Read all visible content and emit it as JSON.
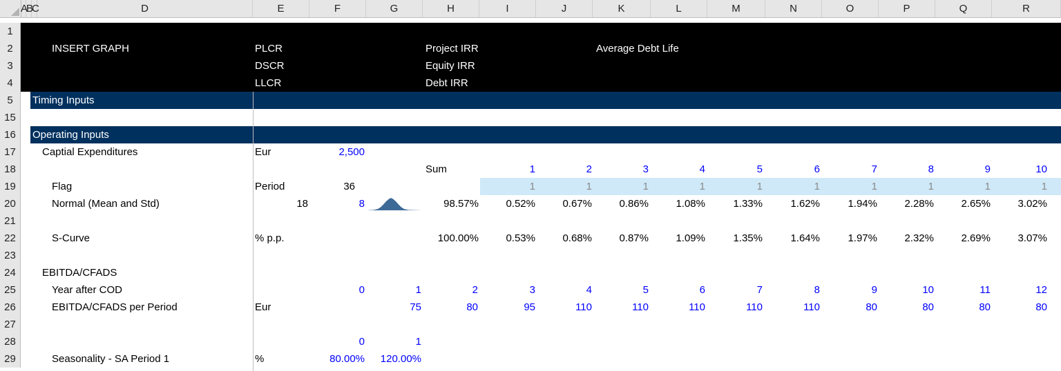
{
  "column_headers": [
    "A",
    "B",
    "C",
    "D",
    "E",
    "F",
    "G",
    "H",
    "I",
    "J",
    "K",
    "L",
    "M",
    "N",
    "O",
    "P",
    "Q",
    "R"
  ],
  "row_headers": [
    "1",
    "2",
    "3",
    "4",
    "5",
    "15",
    "16",
    "17",
    "18",
    "19",
    "20",
    "21",
    "22",
    "23",
    "24",
    "25",
    "26",
    "27",
    "28",
    "29"
  ],
  "header_block": {
    "insert_graph": "INSERT GRAPH",
    "plcr": "PLCR",
    "dscr": "DSCR",
    "llcr": "LLCR",
    "project_irr": "Project IRR",
    "equity_irr": "Equity IRR",
    "debt_irr": "Debt IRR",
    "average_debt_life": "Average Debt Life"
  },
  "sections": {
    "timing_inputs": "Timing Inputs",
    "operating_inputs": "Operating Inputs"
  },
  "capex": {
    "label": "Captial Expenditures",
    "unit": "Eur",
    "value": "2,500"
  },
  "period_row": {
    "sum_label": "Sum",
    "periods": [
      "1",
      "2",
      "3",
      "4",
      "5",
      "6",
      "7",
      "8",
      "9",
      "10"
    ]
  },
  "flag": {
    "label": "Flag",
    "unit": "Period",
    "value": "36",
    "values": [
      "1",
      "1",
      "1",
      "1",
      "1",
      "1",
      "1",
      "1",
      "1",
      "1"
    ]
  },
  "normal": {
    "label": "Normal (Mean and Std)",
    "mean": "18",
    "std": "8",
    "sum": "98.57%",
    "values": [
      "0.52%",
      "0.67%",
      "0.86%",
      "1.08%",
      "1.33%",
      "1.62%",
      "1.94%",
      "2.28%",
      "2.65%",
      "3.02%"
    ]
  },
  "s_curve": {
    "label": "S-Curve",
    "unit": "% p.p.",
    "sum": "100.00%",
    "values": [
      "0.53%",
      "0.68%",
      "0.87%",
      "1.09%",
      "1.35%",
      "1.64%",
      "1.97%",
      "2.32%",
      "2.69%",
      "3.07%"
    ]
  },
  "ebitda_header": "EBITDA/CFADS",
  "year_after_cod": {
    "label": "Year after COD",
    "values": [
      "0",
      "1",
      "2",
      "3",
      "4",
      "5",
      "6",
      "7",
      "8",
      "9",
      "10",
      "11",
      "12"
    ]
  },
  "ebitda_per_period": {
    "label": "EBITDA/CFADS per Period",
    "unit": "Eur",
    "values": [
      "75",
      "80",
      "95",
      "110",
      "110",
      "110",
      "110",
      "110",
      "80",
      "80",
      "80",
      "80"
    ]
  },
  "seasonality_index": [
    "0",
    "1"
  ],
  "seasonality": {
    "label": "Seasonality - SA Period 1",
    "unit": "%",
    "values": [
      "80.00%",
      "120.00%"
    ]
  },
  "colors": {
    "navy_band": "#00305e",
    "header_band": "#000000",
    "input_blue": "#0000ff",
    "flag_fill": "#cfe9f8"
  }
}
